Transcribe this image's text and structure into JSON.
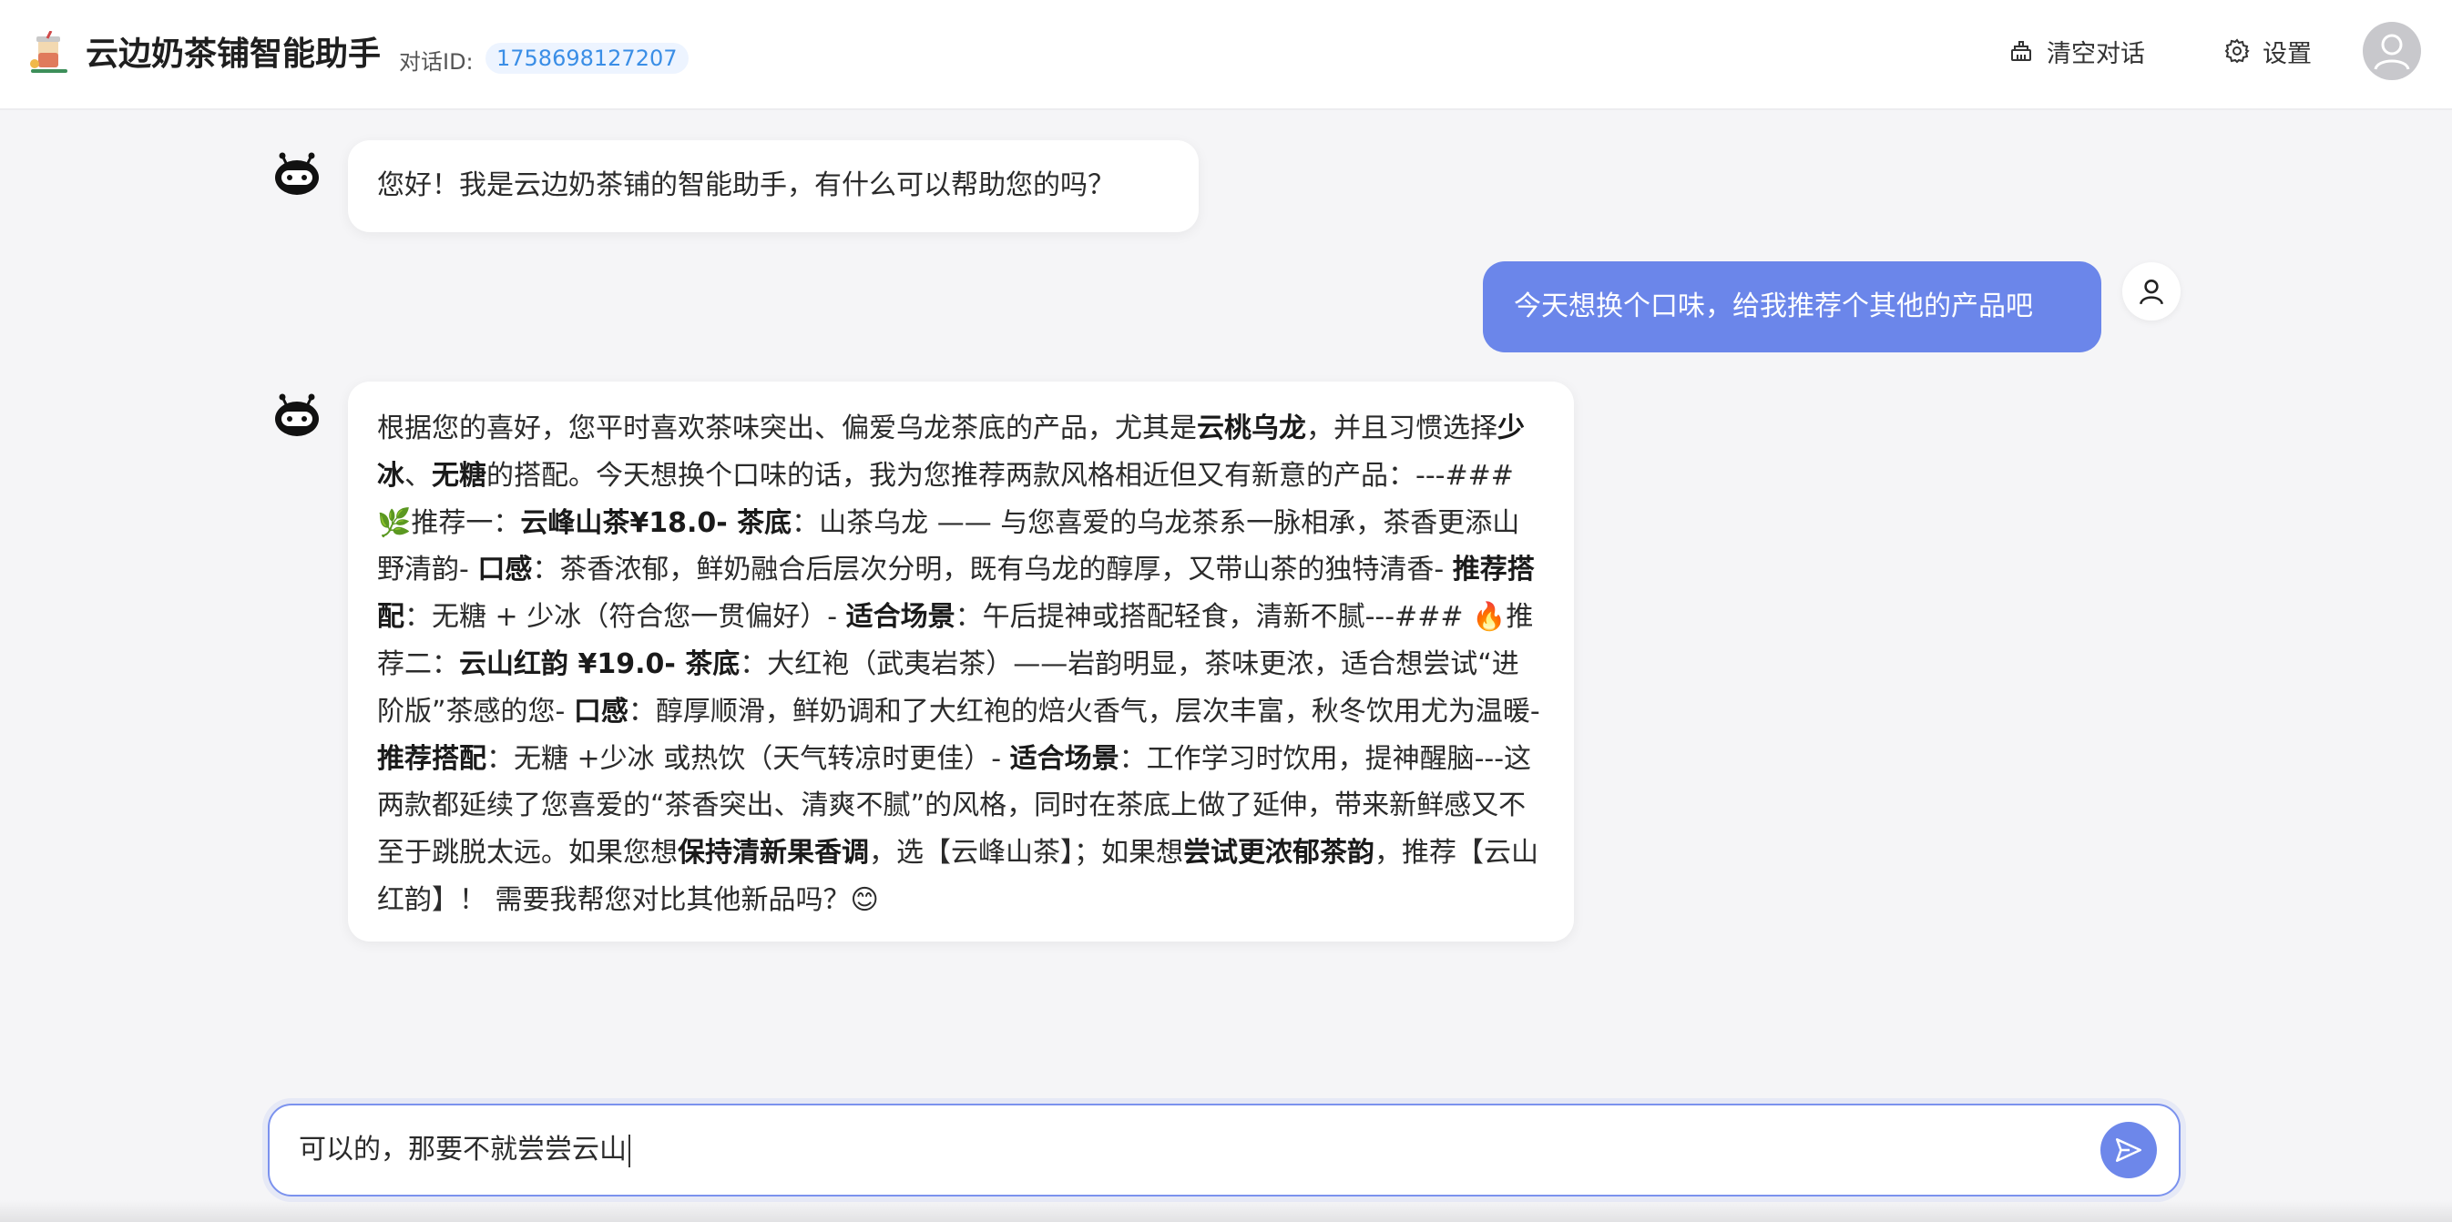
{
  "header": {
    "title": "云边奶茶铺智能助手",
    "conversation_id_label": "对话ID:",
    "conversation_id": "1758698127207",
    "clear_label": "清空对话",
    "settings_label": "设置",
    "icons": {
      "clear": "broom-icon",
      "settings": "gear-icon",
      "avatar": "user-avatar-icon",
      "logo": "milk-tea-logo-icon"
    }
  },
  "messages": [
    {
      "role": "assistant",
      "text": "您好！我是云边奶茶铺的智能助手，有什么可以帮助您的吗？"
    },
    {
      "role": "user",
      "text": "今天想换个口味，给我推荐个其他的产品吧"
    },
    {
      "role": "assistant",
      "segments": [
        {
          "t": "根据您的喜好，您平时喜欢茶味突出、偏爱乌龙茶底的产品，尤其是"
        },
        {
          "t": "云桃乌龙",
          "b": true
        },
        {
          "t": "，并且习惯选择"
        },
        {
          "t": "少冰",
          "b": true
        },
        {
          "t": "、"
        },
        {
          "t": "无糖",
          "b": true
        },
        {
          "t": "的搭配。今天想换个口味的话，我为您推荐两款风格相近但又有新意的产品：---### 🌿推荐一："
        },
        {
          "t": "云峰山茶¥18.0- 茶底",
          "b": true
        },
        {
          "t": "：山茶乌龙 —— 与您喜爱的乌龙茶系一脉相承，茶香更添山野清韵- "
        },
        {
          "t": "口感",
          "b": true
        },
        {
          "t": "：茶香浓郁，鲜奶融合后层次分明，既有乌龙的醇厚，又带山茶的独特清香- "
        },
        {
          "t": "推荐搭配",
          "b": true
        },
        {
          "t": "：无糖 + 少冰（符合您一贯偏好）- "
        },
        {
          "t": "适合场景",
          "b": true
        },
        {
          "t": "：午后提神或搭配轻食，清新不腻---### 🔥推荐二："
        },
        {
          "t": "云山红韵 ¥19.0- 茶底",
          "b": true
        },
        {
          "t": "：大红袍（武夷岩茶）——岩韵明显，茶味更浓，适合想尝试“进阶版”茶感的您- "
        },
        {
          "t": "口感",
          "b": true
        },
        {
          "t": "：醇厚顺滑，鲜奶调和了大红袍的焙火香气，层次丰富，秋冬饮用尤为温暖- "
        },
        {
          "t": "推荐搭配",
          "b": true
        },
        {
          "t": "：无糖 +少冰 或热饮（天气转凉时更佳）- "
        },
        {
          "t": "适合场景",
          "b": true
        },
        {
          "t": "：工作学习时饮用，提神醒脑---这两款都延续了您喜爱的“茶香突出、清爽不腻”的风格，同时在茶底上做了延伸，带来新鲜感又不至于跳脱太远。如果您想"
        },
        {
          "t": "保持清新果香调",
          "b": true
        },
        {
          "t": "，选【云峰山茶】；如果想"
        },
        {
          "t": "尝试更浓郁茶韵",
          "b": true
        },
        {
          "t": "，推荐【云山红韵】！ 需要我帮您对比其他新品吗？😊"
        }
      ]
    }
  ],
  "input": {
    "value": "可以的，那要不就尝尝云山"
  },
  "colors": {
    "accent": "#6b86ea",
    "id_badge_bg": "#edf4ff",
    "id_badge_text": "#3a8ee6"
  }
}
